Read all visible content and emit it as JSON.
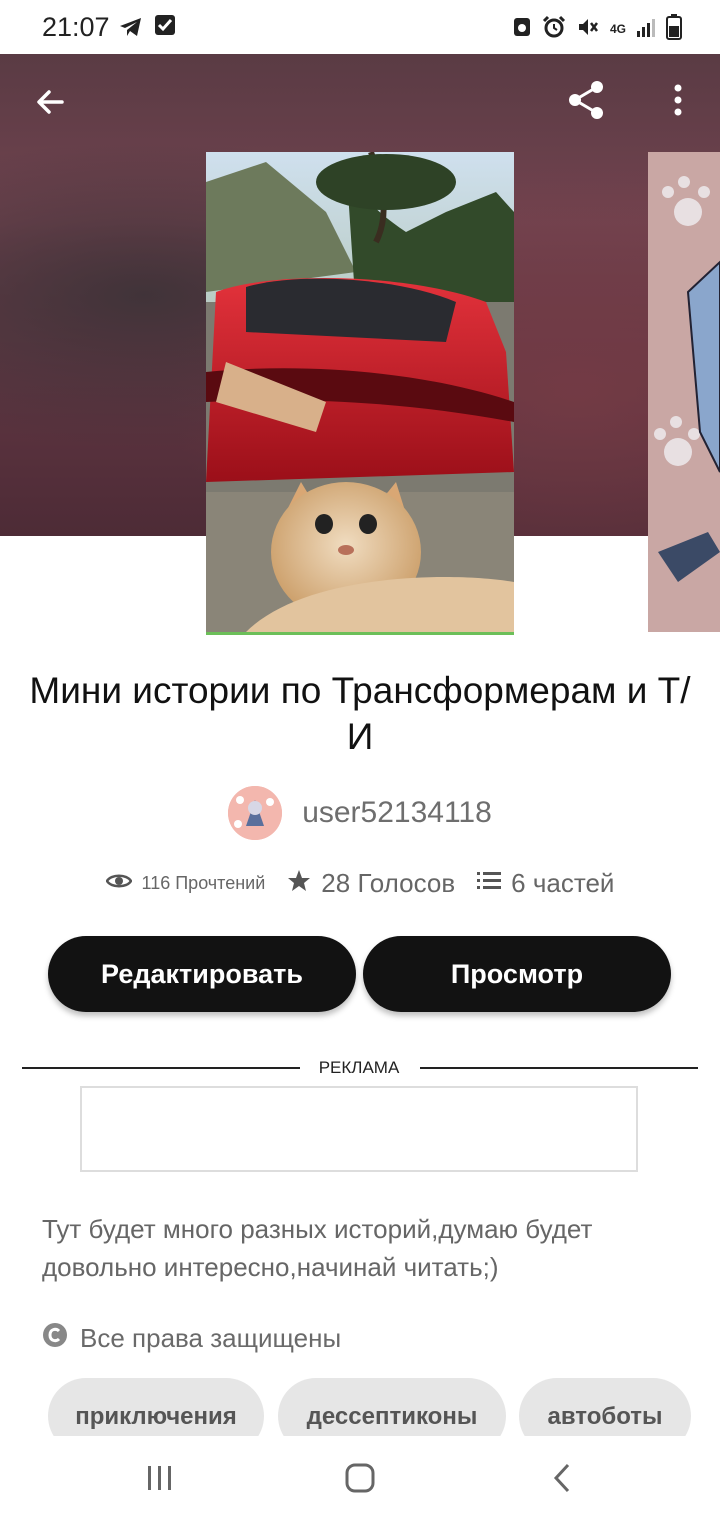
{
  "status_bar": {
    "time": "21:07",
    "left_icons": [
      "telegram-icon",
      "check-square-icon"
    ],
    "right_icons": [
      "recycle-icon",
      "alarm-icon",
      "mute-icon",
      "network-4g-icon",
      "signal-icon",
      "battery-icon"
    ],
    "network_label": "4G"
  },
  "toolbar": {
    "back_icon": "arrow-left-icon",
    "share_icon": "share-icon",
    "more_icon": "more-vertical-icon"
  },
  "story": {
    "title": "Мини истории по Трансформерам и Т/И",
    "author": "user52134118",
    "reads": "116 Прочтений",
    "votes": "28 Голосов",
    "parts": "6 частей"
  },
  "actions": {
    "edit_label": "Редактировать",
    "view_label": "Просмотр"
  },
  "ad": {
    "label": "РЕКЛАМА"
  },
  "description": "Тут будет много разных историй,думаю будет довольно интересно,начинай читать;)",
  "copyright": "Все права защищены",
  "tags": [
    "приключения",
    "дессептиконы",
    "автоботы"
  ],
  "colors": {
    "button_bg": "#121212",
    "tag_bg": "#e6e6e6",
    "hero_bg": "#6a3e4a",
    "cover_underline": "#6cbf59"
  }
}
